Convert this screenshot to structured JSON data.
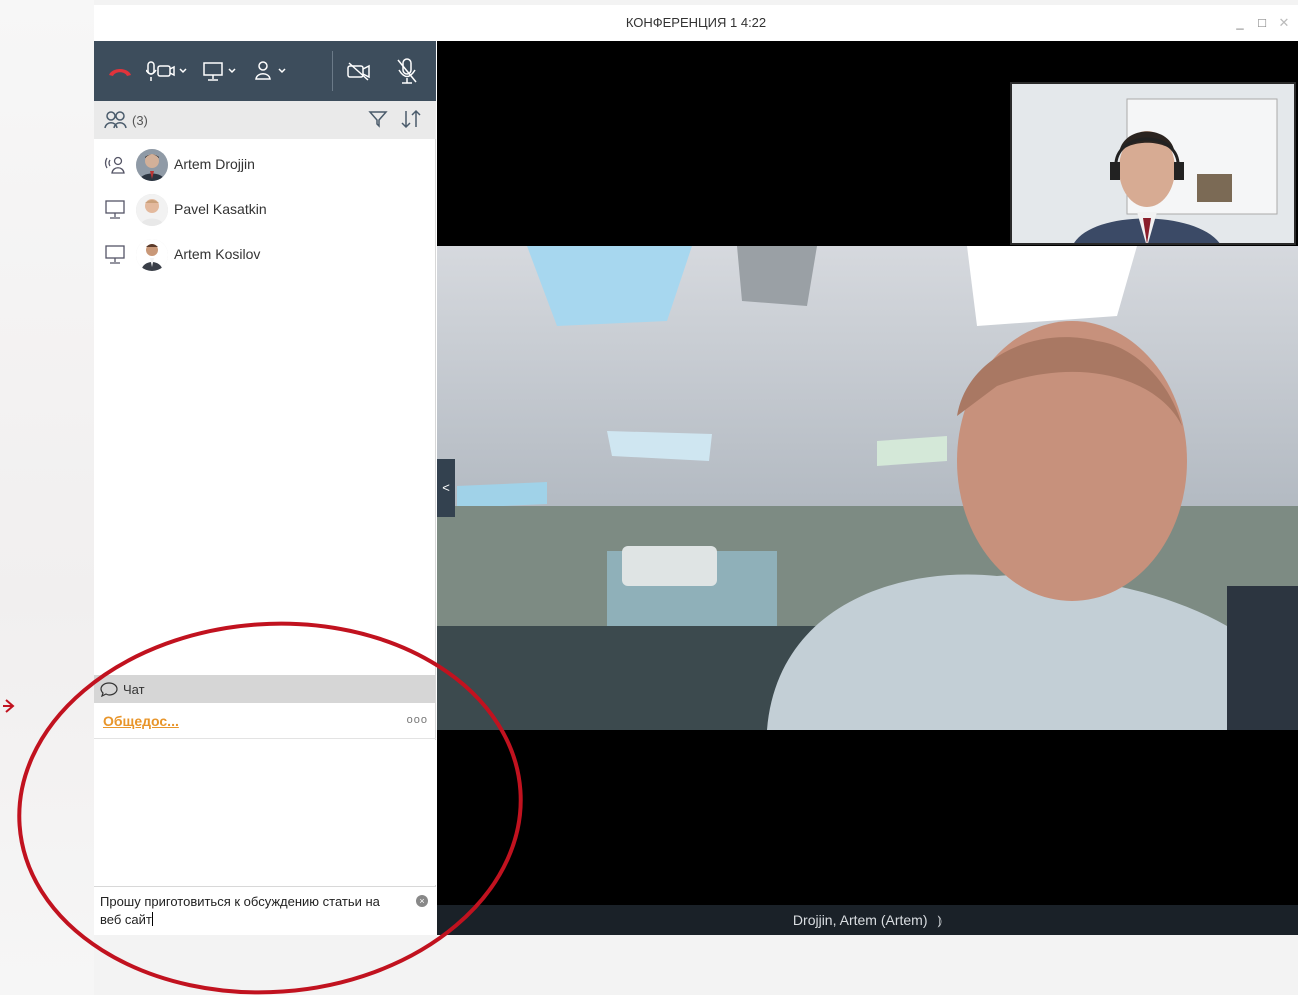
{
  "window": {
    "title": "КОНФЕРЕНЦИЯ 1 4:22",
    "controls": {
      "minimize": "_",
      "maximize": "□",
      "close": "✕"
    }
  },
  "toolbar": {
    "buttons": [
      {
        "name": "hangup-icon",
        "color": "#e2333b"
      },
      {
        "name": "microphone-camera-menu-icon"
      },
      {
        "name": "screen-share-menu-icon"
      },
      {
        "name": "user-menu-icon"
      },
      {
        "name": "camera-off-icon"
      },
      {
        "name": "microphone-off-icon"
      }
    ]
  },
  "participants": {
    "count_label": "(3)",
    "items": [
      {
        "name": "Artem Drojjin",
        "status_icon": "speaking-icon"
      },
      {
        "name": "Pavel Kasatkin",
        "status_icon": "monitor-icon"
      },
      {
        "name": "Artem Kosilov",
        "status_icon": "monitor-icon"
      }
    ]
  },
  "chat": {
    "header_label": "Чат",
    "tab_label": "Общедос...",
    "more_label": "ooo",
    "input_value": "Прошу приготовиться к обсуждению статьи на веб сайт"
  },
  "video": {
    "speaker_label": "Drojjin, Artem (Artem)",
    "collapse_label": "<"
  },
  "colors": {
    "toolbar_bg": "#3d4d5c",
    "accent_orange": "#e8952a",
    "annotation_red": "#c1121f"
  }
}
